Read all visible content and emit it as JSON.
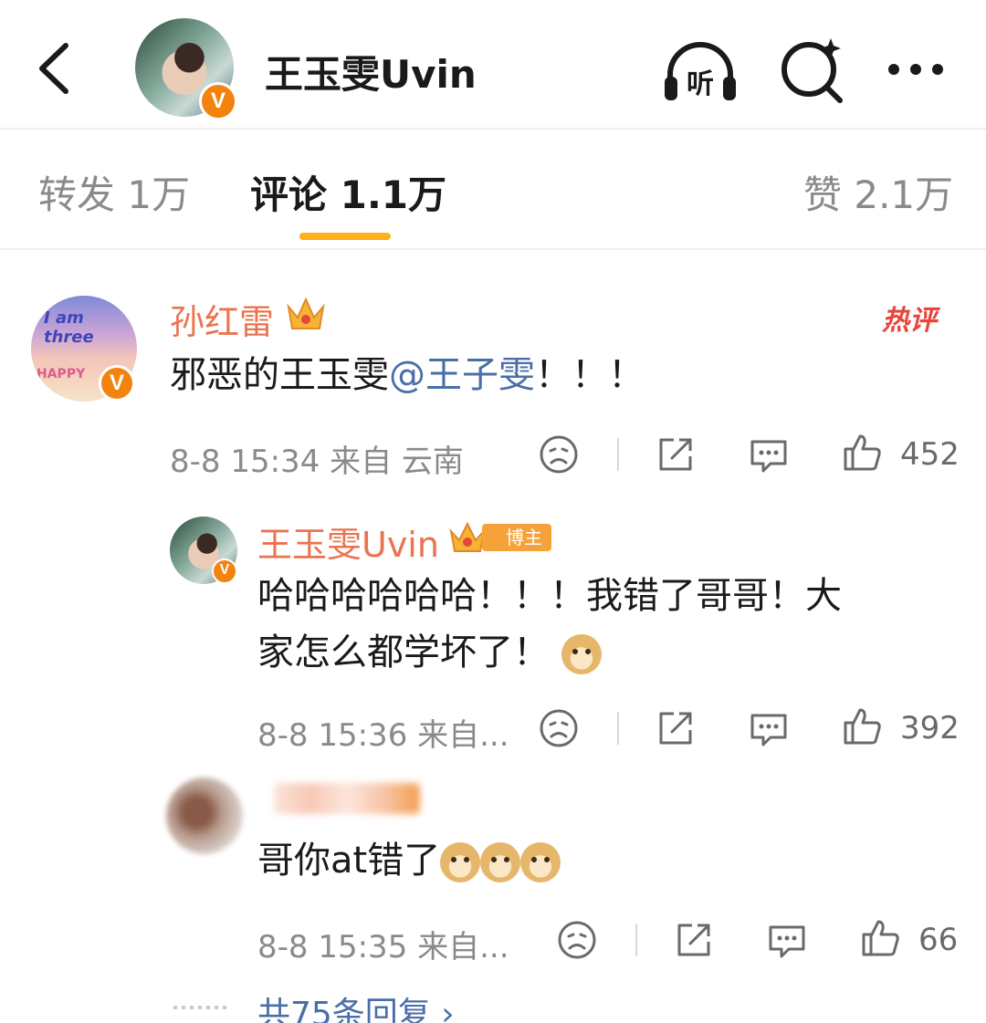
{
  "header": {
    "title": "王玉雯Uvin",
    "verified_badge": "V",
    "listen_icon_text": "听",
    "icons": [
      "back-arrow-icon",
      "headphones-icon",
      "search-icon",
      "more-icon"
    ]
  },
  "tabs": [
    {
      "label": "转发 1万"
    },
    {
      "label": "评论 1.1万"
    },
    {
      "label": "赞 2.1万"
    }
  ],
  "colors": {
    "accent": "#ffb11b",
    "username": "#eb7350",
    "mention": "#4a6ea8",
    "verified": "#f2830f"
  },
  "comments": [
    {
      "user": "孙红雷",
      "badge": "V",
      "avatar_text_1": "I am three",
      "avatar_text_2": "HAPPY",
      "hot_label": "热评",
      "text_pre": "邪恶的王玉雯",
      "mention": "@王子雯",
      "text_post": "！！！",
      "meta": "8-8 15:34 来自 云南",
      "likes": "452"
    },
    {
      "user": "王玉雯Uvin",
      "badge": "V",
      "role_tag": "博主",
      "text_line1": "哈哈哈哈哈哈！！！我错了哥哥！大",
      "text_line2": "家怎么都学坏了！",
      "meta": "8-8 15:36 来自...",
      "likes": "392"
    },
    {
      "text": "哥你at错了",
      "meta": "8-8 15:35 来自...",
      "likes": "66"
    }
  ],
  "more_replies": "共75条回复 ›"
}
